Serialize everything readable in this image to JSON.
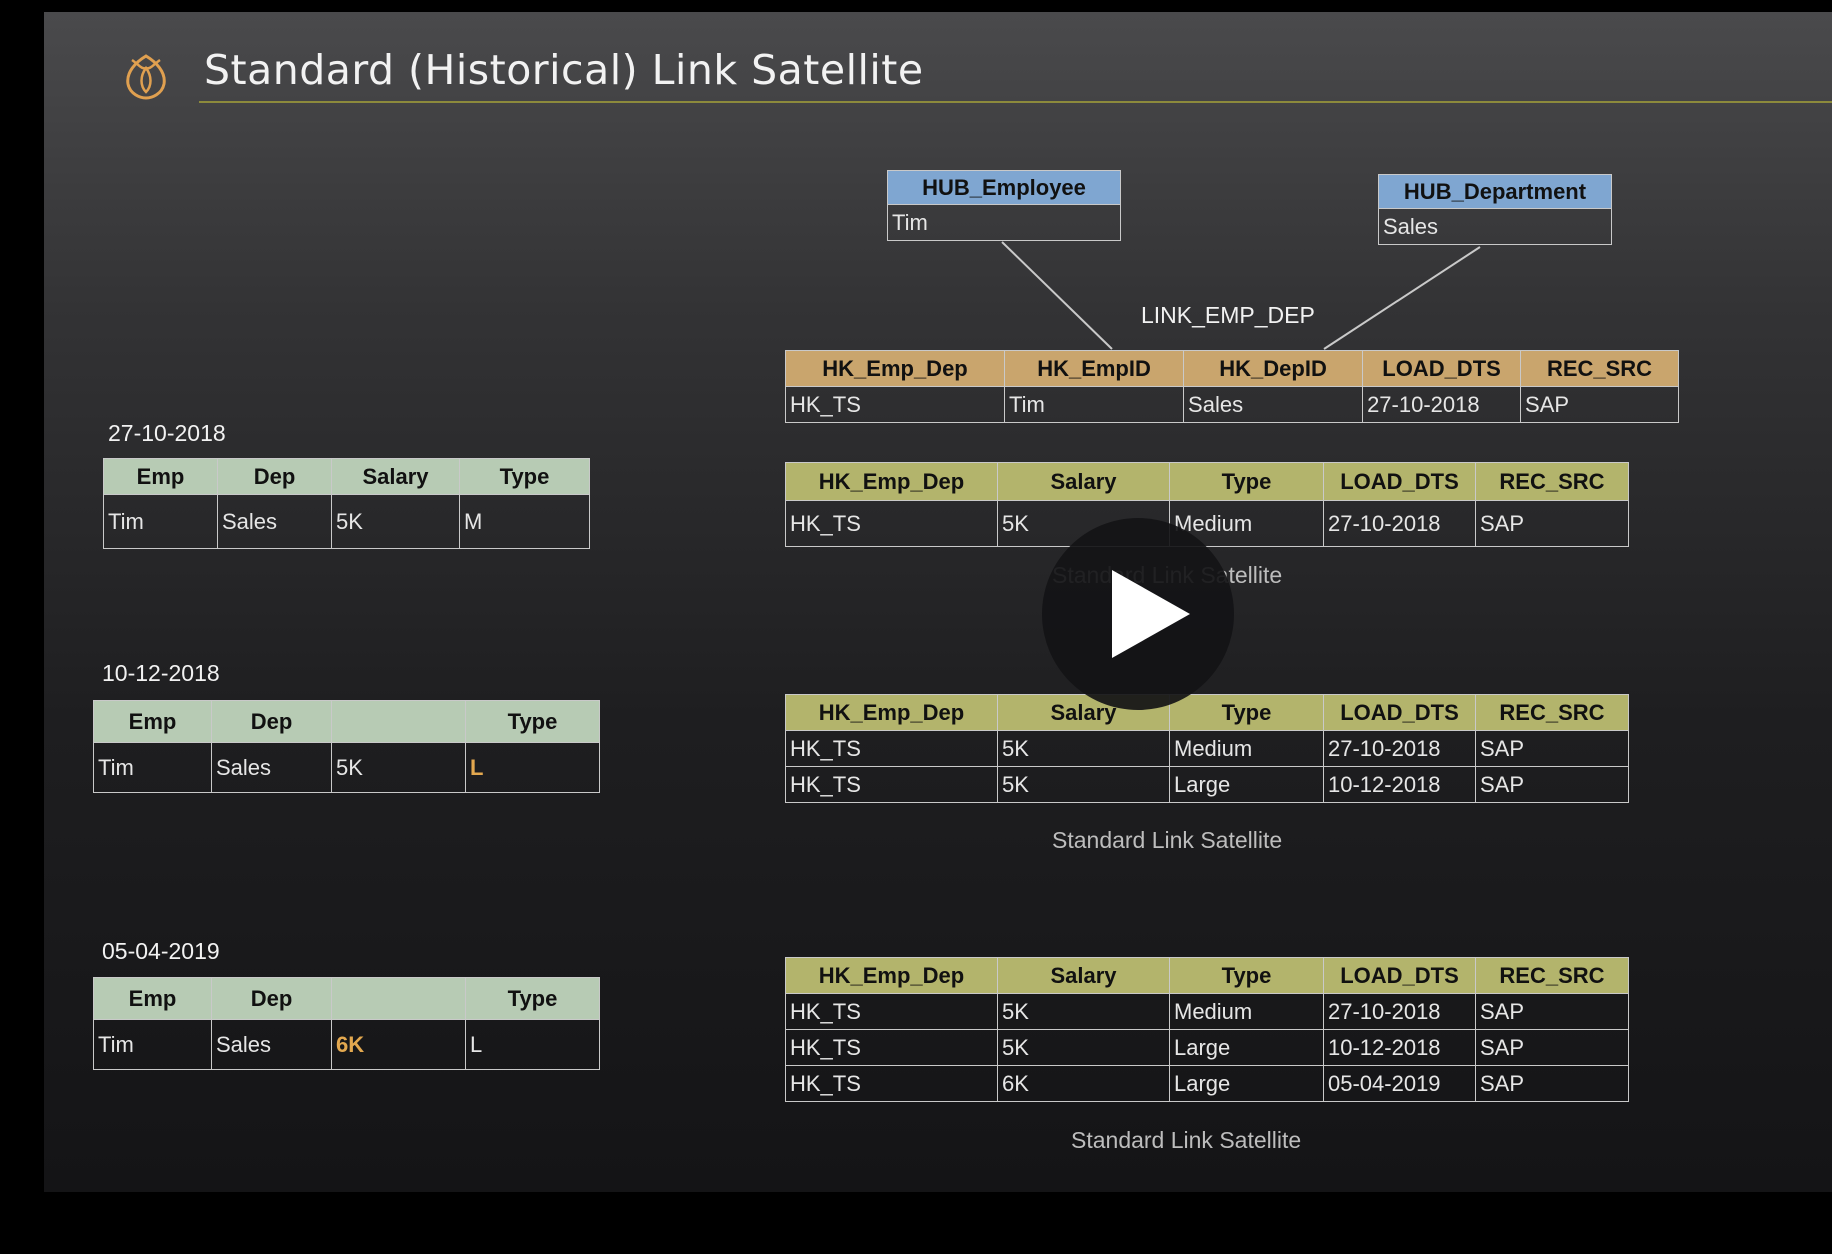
{
  "title": "Standard (Historical) Link Satellite",
  "hub_employee": {
    "header": "HUB_Employee",
    "value": "Tim"
  },
  "hub_department": {
    "header": "HUB_Department",
    "value": "Sales"
  },
  "link": {
    "name": "LINK_EMP_DEP",
    "columns": [
      "HK_Emp_Dep",
      "HK_EmpID",
      "HK_DepID",
      "LOAD_DTS",
      "REC_SRC"
    ],
    "row": [
      "HK_TS",
      "Tim",
      "Sales",
      "27-10-2018",
      "SAP"
    ]
  },
  "sources": [
    {
      "date": "27-10-2018",
      "columns": [
        "Emp",
        "Dep",
        "Salary",
        "Type"
      ],
      "row": [
        "Tim",
        "Sales",
        "5K",
        "M"
      ]
    },
    {
      "date": "10-12-2018",
      "columns": [
        "Emp",
        "Dep",
        "",
        "Type"
      ],
      "row": [
        "Tim",
        "Sales",
        "5K",
        "L"
      ]
    },
    {
      "date": "05-04-2019",
      "columns": [
        "Emp",
        "Dep",
        "",
        "Type"
      ],
      "row": [
        "Tim",
        "Sales",
        "6K",
        "L"
      ]
    }
  ],
  "satellites": [
    {
      "columns": [
        "HK_Emp_Dep",
        "Salary",
        "Type",
        "LOAD_DTS",
        "REC_SRC"
      ],
      "rows": [
        [
          "HK_TS",
          "5K",
          "Medium",
          "27-10-2018",
          "SAP"
        ]
      ],
      "caption": "Standard Link Satellite"
    },
    {
      "columns": [
        "HK_Emp_Dep",
        "Salary",
        "Type",
        "LOAD_DTS",
        "REC_SRC"
      ],
      "rows": [
        [
          "HK_TS",
          "5K",
          "Medium",
          "27-10-2018",
          "SAP"
        ],
        [
          "HK_TS",
          "5K",
          "Large",
          "10-12-2018",
          "SAP"
        ]
      ],
      "caption": "Standard Link Satellite"
    },
    {
      "columns": [
        "HK_Emp_Dep",
        "Salary",
        "Type",
        "LOAD_DTS",
        "REC_SRC"
      ],
      "rows": [
        [
          "HK_TS",
          "5K",
          "Medium",
          "27-10-2018",
          "SAP"
        ],
        [
          "HK_TS",
          "5K",
          "Large",
          "10-12-2018",
          "SAP"
        ],
        [
          "HK_TS",
          "6K",
          "Large",
          "05-04-2019",
          "SAP"
        ]
      ],
      "caption": "Standard Link Satellite"
    }
  ]
}
